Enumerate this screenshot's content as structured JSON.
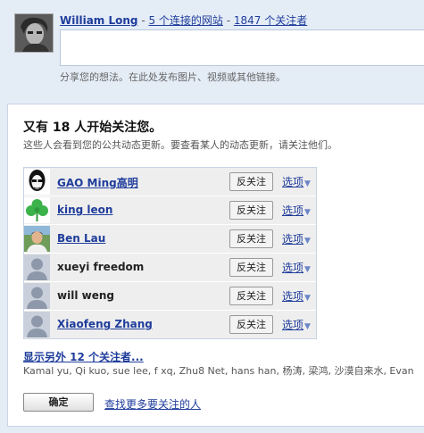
{
  "top": {
    "user_name": "William Long",
    "sep1": " - ",
    "sites_link": "5 个连接的网站",
    "sep2": " - ",
    "followers_link": "1847 个关注者",
    "post_hint": "分享您的想法。在此处发布图片、视频或其他链接。"
  },
  "card": {
    "title": "又有 18 人开始关注您。",
    "subtitle": "这些人会看到您的公共动态更新。要查看某人的动态更新，请关注他们。",
    "rows": [
      {
        "name": "GAO Ming高明",
        "linked": true,
        "avatar": "cartoon-face-avatar",
        "unfollow_label": "反关注",
        "options_label": "选项"
      },
      {
        "name": "king leon",
        "linked": true,
        "avatar": "clover-avatar",
        "unfollow_label": "反关注",
        "options_label": "选项"
      },
      {
        "name": "Ben Lau",
        "linked": true,
        "avatar": "photo-avatar",
        "unfollow_label": "反关注",
        "options_label": "选项"
      },
      {
        "name": "xueyi freedom",
        "linked": false,
        "avatar": "default-avatar",
        "unfollow_label": "反关注",
        "options_label": "选项"
      },
      {
        "name": "will weng",
        "linked": false,
        "avatar": "default-avatar",
        "unfollow_label": "反关注",
        "options_label": "选项"
      },
      {
        "name": "Xiaofeng Zhang",
        "linked": true,
        "avatar": "default-avatar",
        "unfollow_label": "反关注",
        "options_label": "选项"
      }
    ],
    "show_more": "显示另外 12 个关注者...",
    "other_names": "Kamal yu, Qi kuo, sue lee, f xq, Zhu8 Net, hans han, 杨涛, 梁鸿, 沙漠自来水, Evan",
    "ok_label": "确定",
    "find_more": "查找更多要关注的人"
  },
  "colors": {
    "link": "#1f3d9b",
    "page_bg": "#e4ecf6",
    "row_bg": "#eeeeee"
  }
}
